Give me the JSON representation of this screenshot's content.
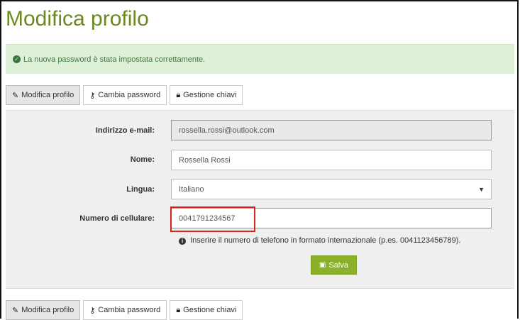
{
  "page": {
    "title": "Modifica profilo"
  },
  "alert": {
    "message": "La nuova password è stata impostata correttamente.",
    "icon": "check-circle-icon",
    "color": "#dff0d8"
  },
  "tabs": [
    {
      "label": "Modifica profilo",
      "icon": "pencil-icon",
      "active": true
    },
    {
      "label": "Cambia password",
      "icon": "key-icon",
      "active": false
    },
    {
      "label": "Gestione chiavi",
      "icon": "lock-icon",
      "active": false
    }
  ],
  "form": {
    "email": {
      "label": "Indirizzo e-mail:",
      "value": "rossella.rossi@outlook.com"
    },
    "name": {
      "label": "Nome:",
      "value": "Rossella Rossi"
    },
    "language": {
      "label": "Lingua:",
      "value": "Italiano"
    },
    "phone": {
      "label": "Numero di cellulare:",
      "value": "0041791234567",
      "hint": "Inserire il numero di telefono in formato internazionale (p.es. 0041123456789)."
    },
    "save_label": "Salva"
  },
  "colors": {
    "title": "#6b8a1e",
    "save_button": "#8cb02a",
    "highlight": "#d9231f"
  }
}
